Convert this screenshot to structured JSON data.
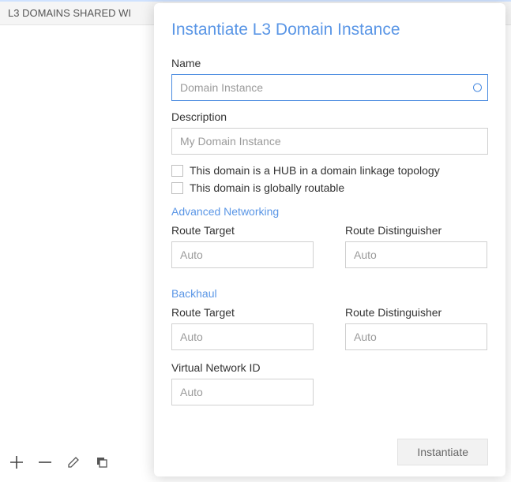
{
  "background_panel": {
    "header": "L3 DOMAINS SHARED WI"
  },
  "modal": {
    "title": "Instantiate L3 Domain Instance",
    "name": {
      "label": "Name",
      "placeholder": "Domain Instance",
      "value": ""
    },
    "description": {
      "label": "Description",
      "placeholder": "My Domain Instance",
      "value": ""
    },
    "checkboxes": {
      "hub": {
        "label": "This domain is a HUB in a domain linkage topology",
        "checked": false
      },
      "global": {
        "label": "This domain is globally routable",
        "checked": false
      }
    },
    "sections": {
      "advanced": {
        "heading": "Advanced Networking",
        "route_target": {
          "label": "Route Target",
          "placeholder": "Auto",
          "value": ""
        },
        "route_distinguisher": {
          "label": "Route Distinguisher",
          "placeholder": "Auto",
          "value": ""
        }
      },
      "backhaul": {
        "heading": "Backhaul",
        "route_target": {
          "label": "Route Target",
          "placeholder": "Auto",
          "value": ""
        },
        "route_distinguisher": {
          "label": "Route Distinguisher",
          "placeholder": "Auto",
          "value": ""
        },
        "vni": {
          "label": "Virtual Network ID",
          "placeholder": "Auto",
          "value": ""
        }
      }
    },
    "footer": {
      "instantiate": "Instantiate"
    }
  },
  "toolbar": {
    "add": "add",
    "remove": "remove",
    "edit": "edit",
    "copy": "copy"
  }
}
